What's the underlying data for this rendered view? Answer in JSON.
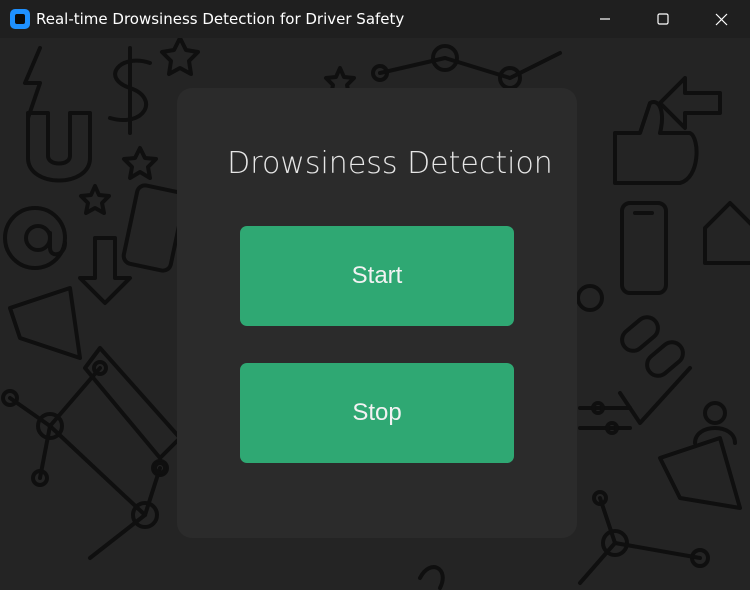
{
  "window": {
    "title": "Real-time Drowsiness Detection for Driver Safety",
    "controls": [
      "minimize-icon",
      "maximize-icon",
      "close-icon"
    ]
  },
  "panel": {
    "heading": "Drowsiness Detection",
    "start_label": "Start",
    "stop_label": "Stop"
  },
  "colors": {
    "accent": "#2fa873",
    "panel": "#2b2b2b",
    "background": "#242424",
    "app_icon": "#1e90ff"
  },
  "background_icons": [
    "lightning-icon",
    "dollar-icon",
    "magnet-icon",
    "star-icon",
    "at-icon",
    "phone-icon",
    "arrow-icon",
    "thumbs-up-icon",
    "house-icon",
    "network-icon",
    "megaphone-icon",
    "chain-link-icon",
    "users-icon",
    "slider-icon"
  ]
}
